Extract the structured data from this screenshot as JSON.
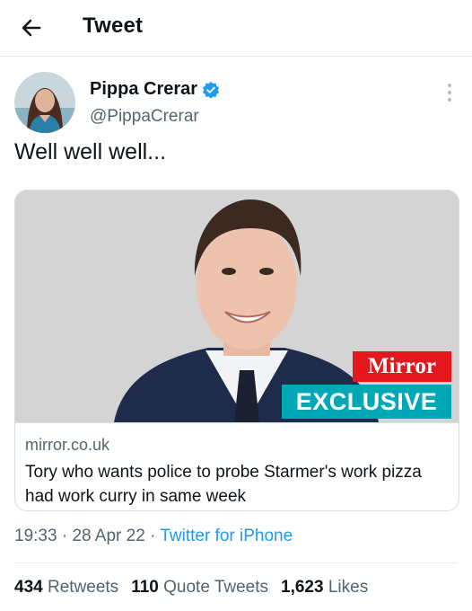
{
  "header": {
    "title": "Tweet",
    "back_icon": "arrow-left-icon"
  },
  "author": {
    "name": "Pippa Crerar",
    "handle": "@PippaCrerar",
    "verified_icon": "verified-badge-icon",
    "verified_color": "#1d9bf0"
  },
  "tweet": {
    "text": "Well well well..."
  },
  "card": {
    "domain": "mirror.co.uk",
    "title": "Tory who wants police to probe Starmer's work pizza had work curry in same week",
    "badge_top": "Mirror",
    "badge_bottom": "EXCLUSIVE",
    "badge_top_color": "#e3171d",
    "badge_bottom_color": "#00a7b5"
  },
  "meta": {
    "time": "19:33",
    "date": "28 Apr 22",
    "source": "Twitter for iPhone",
    "separator": "·"
  },
  "stats": {
    "retweets_count": "434",
    "retweets_label": "Retweets",
    "quotes_count": "110",
    "quotes_label": "Quote Tweets",
    "likes_count": "1,623",
    "likes_label": "Likes"
  },
  "accent_color": "#1d9bf0"
}
